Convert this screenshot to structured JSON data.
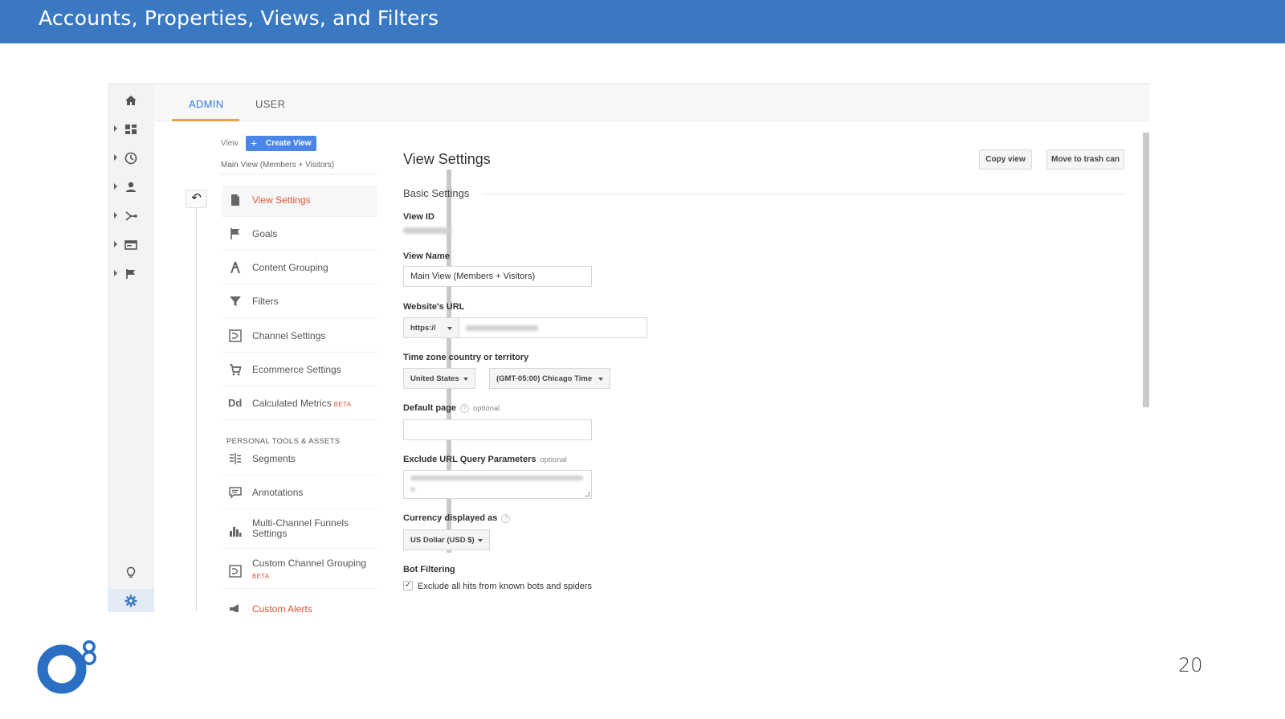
{
  "slide": {
    "title": "Accounts, Properties, Views, and Filters",
    "page_number": "20",
    "brand_color": "#3a78c2"
  },
  "tabs": {
    "admin": "ADMIN",
    "user": "USER"
  },
  "rail_icons": [
    "home-icon",
    "dashboard-icon",
    "clock-icon",
    "person-icon",
    "acquisition-icon",
    "behavior-icon",
    "flag-icon",
    "lightbulb-icon",
    "gear-icon"
  ],
  "view_header": {
    "label": "View",
    "create_button": "Create View",
    "current_view": "Main View (Members + Visitors)"
  },
  "nav": {
    "items": [
      {
        "label": "View Settings",
        "icon": "document-icon",
        "active": true
      },
      {
        "label": "Goals",
        "icon": "flag-icon"
      },
      {
        "label": "Content Grouping",
        "icon": "grouping-icon"
      },
      {
        "label": "Filters",
        "icon": "filter-icon"
      },
      {
        "label": "Channel Settings",
        "icon": "channel-icon"
      },
      {
        "label": "Ecommerce Settings",
        "icon": "cart-icon"
      },
      {
        "label": "Calculated Metrics",
        "icon": "dd-icon",
        "badge": "BETA"
      }
    ],
    "section_title": "PERSONAL TOOLS & ASSETS",
    "personal_items": [
      {
        "label": "Segments",
        "icon": "segments-icon"
      },
      {
        "label": "Annotations",
        "icon": "comment-icon"
      },
      {
        "label": "Multi-Channel Funnels Settings",
        "icon": "bar-chart-icon"
      },
      {
        "label": "Custom Channel Grouping",
        "icon": "channel-icon",
        "badge": "BETA"
      },
      {
        "label": "Custom Alerts",
        "icon": "megaphone-icon"
      }
    ]
  },
  "settings": {
    "title": "View Settings",
    "copy_button": "Copy view",
    "trash_button": "Move to trash can",
    "section": "Basic Settings",
    "view_id_label": "View ID",
    "view_name_label": "View Name",
    "view_name_value": "Main View (Members + Visitors)",
    "website_url_label": "Website's URL",
    "protocol": "https://",
    "timezone_label": "Time zone country or territory",
    "country": "United States",
    "timezone": "(GMT-05:00) Chicago Time",
    "default_page_label": "Default page",
    "optional": "optional",
    "help": "?",
    "exclude_label": "Exclude URL Query Parameters",
    "currency_label": "Currency displayed as",
    "currency": "US Dollar (USD $)",
    "bot_label": "Bot Filtering",
    "bot_checkbox_label": "Exclude all hits from known bots and spiders",
    "bot_checked": true
  },
  "colors": {
    "accent_blue": "#2f7ae0",
    "active_orange": "#e0533b",
    "tab_underline": "#e8a33b"
  }
}
